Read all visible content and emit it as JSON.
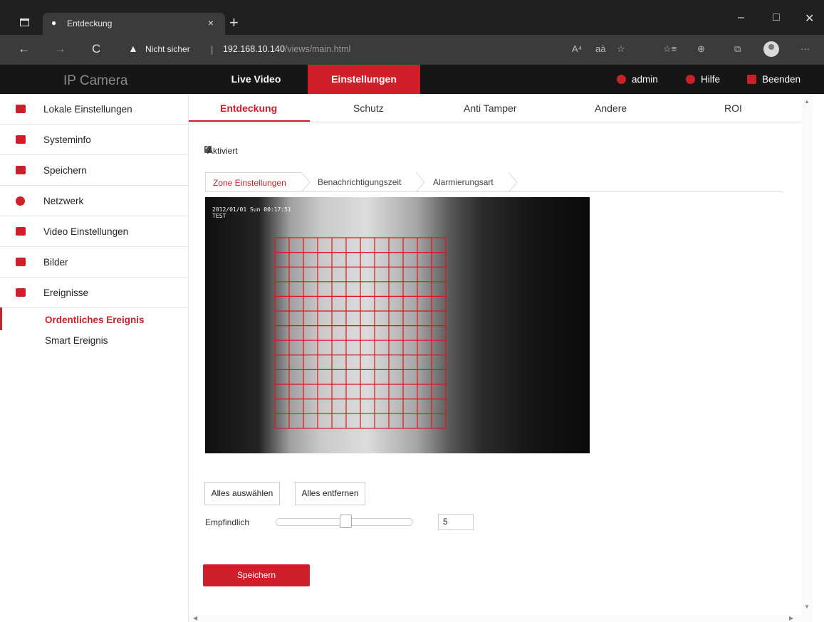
{
  "browser": {
    "tab_title": "Entdeckung",
    "tab_close": "×",
    "new_tab": "+",
    "controls": {
      "minimize": "–",
      "maximize": "□",
      "close": "✕"
    },
    "nav": {
      "back": "←",
      "forward": "→",
      "reload": "C"
    },
    "security_label": "Nicht sicher",
    "separator": "|",
    "url_host": "192.168.10.140",
    "url_path": "/views/main.html",
    "toolbar_icons": {
      "read_aloud": "A⁴",
      "immersive": "aà",
      "favorite": "☆",
      "favorites": "☆≡",
      "collections": "⊕",
      "extensions": "⧉",
      "more": "···"
    }
  },
  "header": {
    "brand": "IP Camera",
    "nav": {
      "live": "Live Video",
      "settings": "Einstellungen"
    },
    "user": "admin",
    "help": "Hilfe",
    "exit": "Beenden"
  },
  "sidebar": {
    "items": [
      {
        "label": "Lokale Einstellungen",
        "icon": "monitor-icon"
      },
      {
        "label": "Systeminfo",
        "icon": "info-window-icon"
      },
      {
        "label": "Speichern",
        "icon": "floppy-icon"
      },
      {
        "label": "Netzwerk",
        "icon": "globe-icon"
      },
      {
        "label": "Video Einstellungen",
        "icon": "video-icon"
      },
      {
        "label": "Bilder",
        "icon": "image-icon"
      },
      {
        "label": "Ereignisse",
        "icon": "events-icon"
      }
    ],
    "sub_items": [
      {
        "label": "Ordentliches Ereignis",
        "active": true
      },
      {
        "label": "Smart Ereignis",
        "active": false
      }
    ]
  },
  "tabs": [
    "Entdeckung",
    "Schutz",
    "Anti Tamper",
    "Andere",
    "ROI"
  ],
  "enabled_label": "Aktiviert",
  "enabled": true,
  "steps": [
    "Zone Einstellungen",
    "Benachrichtigungszeit",
    "Alarmierungsart"
  ],
  "video": {
    "timestamp": "2012/01/01 Sun 00:17:51",
    "osd": "TEST",
    "grid_color": "#e0131b"
  },
  "buttons": {
    "select_all": "Alles auswählen",
    "remove_all": "Alles entfernen",
    "save": "Speichern"
  },
  "sensitivity": {
    "label": "Empfindlich",
    "value": "5"
  },
  "accent_color": "#c9202a"
}
